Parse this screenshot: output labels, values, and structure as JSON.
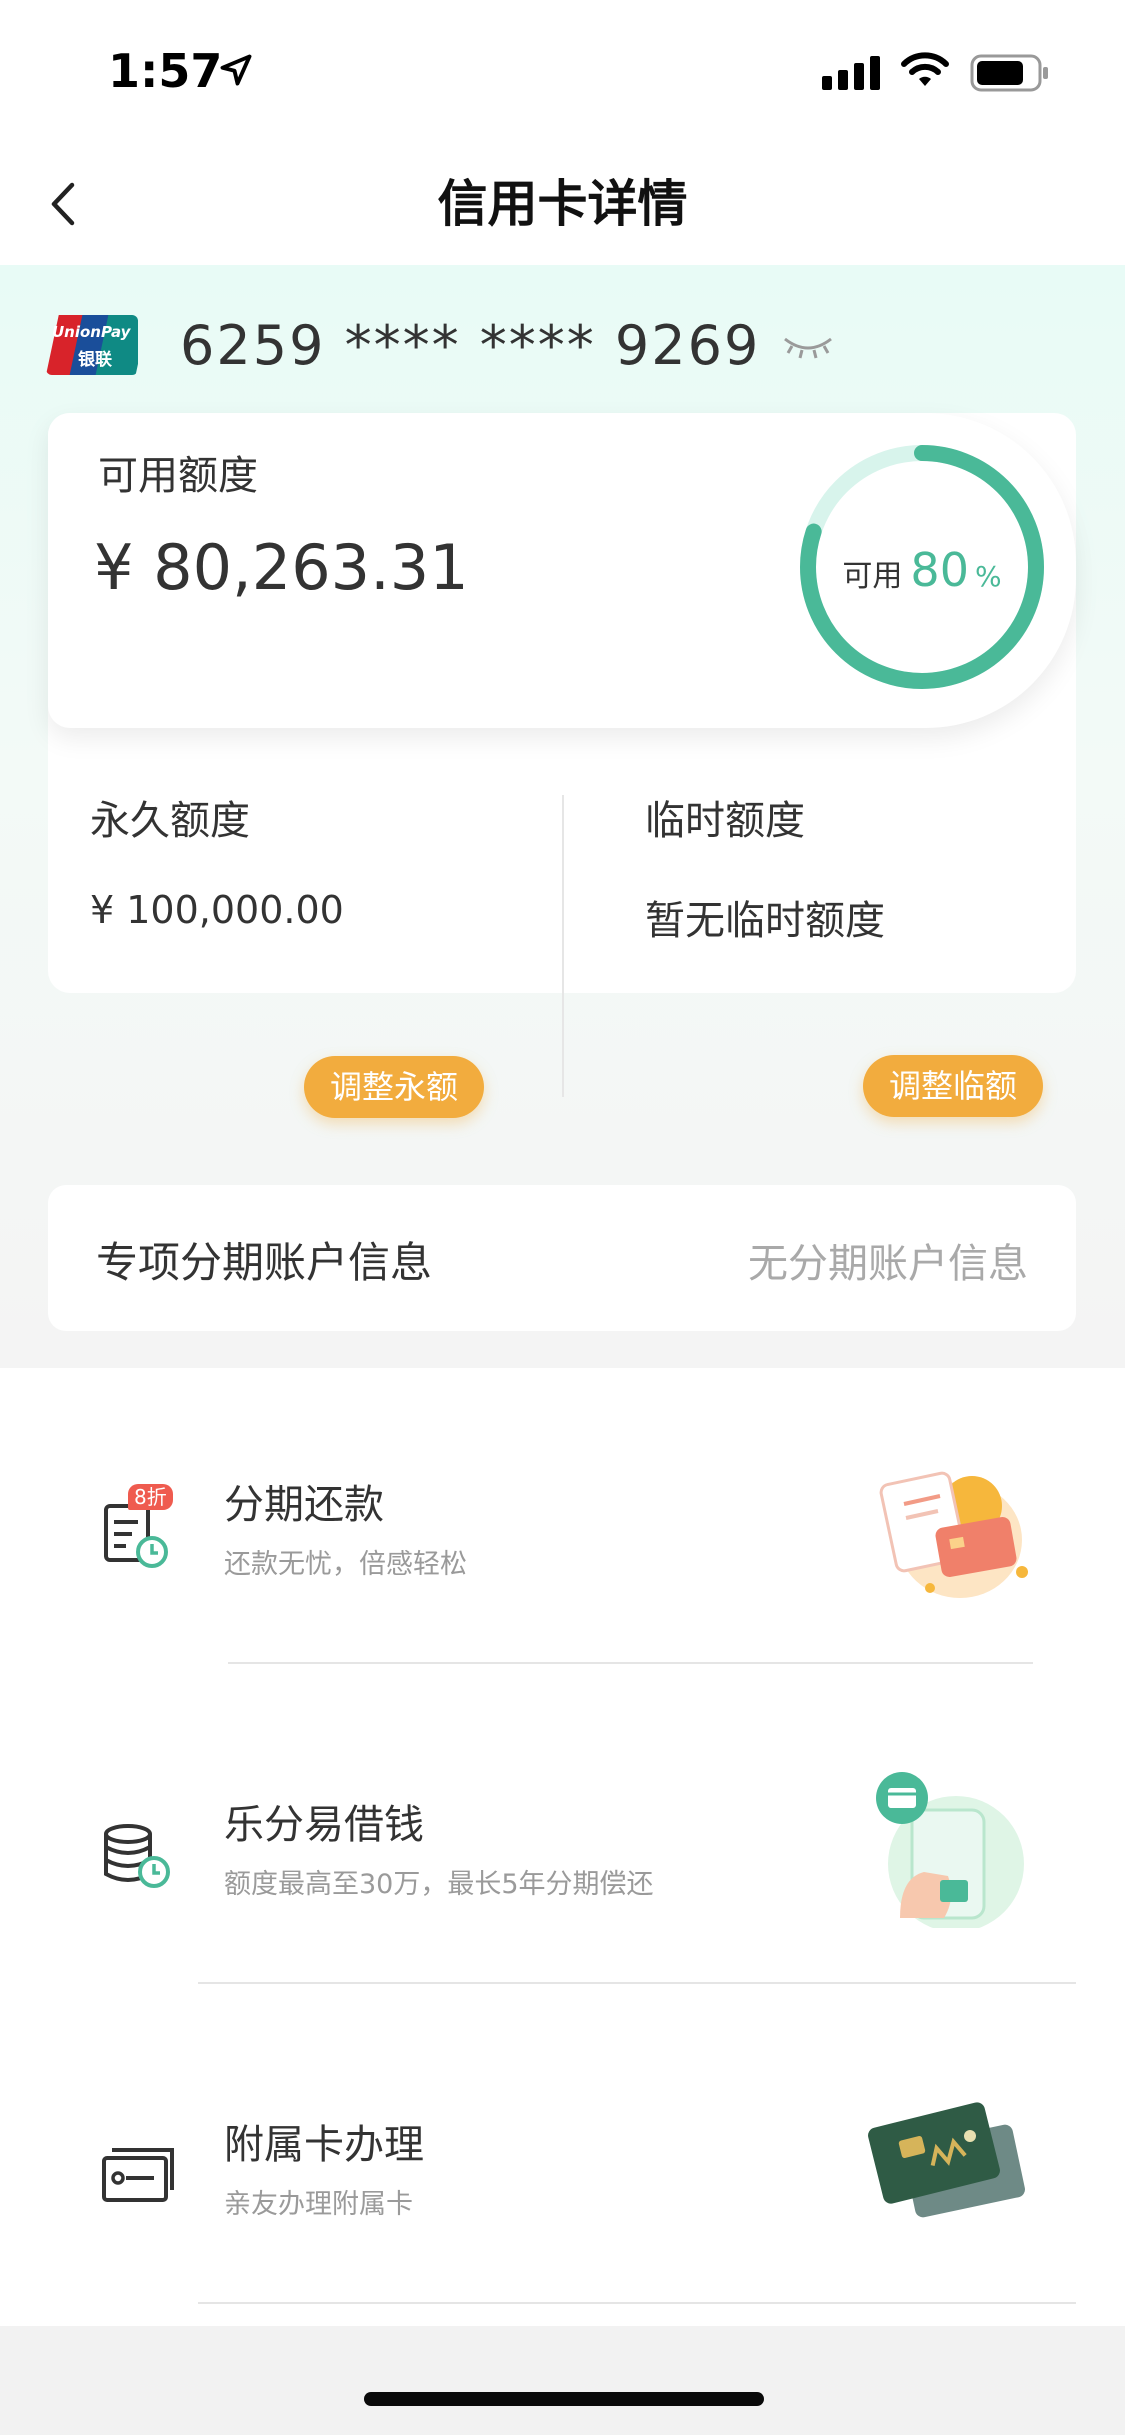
{
  "status_bar": {
    "time": "1:57",
    "icons": [
      "location-arrow-icon",
      "signal-icon",
      "wifi-icon",
      "battery-icon"
    ]
  },
  "header": {
    "title": "信用卡详情",
    "back_icon": "chevron-left-icon"
  },
  "card": {
    "brand": "UnionPay 银联",
    "number": "6259 **** **** 9269",
    "eye_icon": "eye-closed-icon"
  },
  "available": {
    "label": "可用额度",
    "amount": "¥ 80,263.31",
    "ring_prefix": "可用",
    "ring_percent": "80",
    "ring_unit": "%",
    "ring_fraction": 0.8,
    "accent_color": "#4ab998",
    "track_color": "#d8f4ec"
  },
  "limits": {
    "permanent": {
      "label": "永久额度",
      "value": "¥ 100,000.00",
      "button": "调整永额"
    },
    "temporary": {
      "label": "临时额度",
      "value": "暂无临时额度",
      "button": "调整临额"
    },
    "button_color": "#f2ac3e"
  },
  "installment_account": {
    "label": "专项分期账户信息",
    "value": "无分期账户信息"
  },
  "services": [
    {
      "title": "分期还款",
      "subtitle": "还款无忧，倍感轻松",
      "badge": "8折",
      "icon": "bill-clock-icon"
    },
    {
      "title": "乐分易借钱",
      "subtitle": "额度最高至30万，最长5年分期偿还",
      "icon": "coins-clock-icon"
    },
    {
      "title": "附属卡办理",
      "subtitle": "亲友办理附属卡",
      "icon": "card-icon"
    }
  ]
}
